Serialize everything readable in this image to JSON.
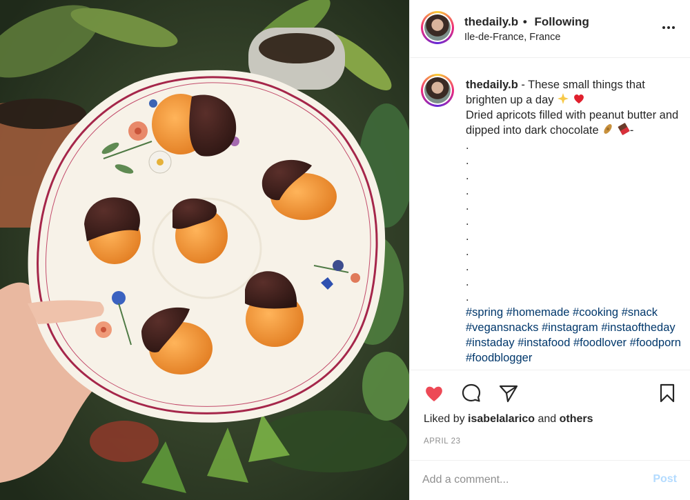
{
  "post": {
    "username": "thedaily.b",
    "follow_separator": "•",
    "follow_status": "Following",
    "location": "Ile-de-France, France"
  },
  "caption": {
    "username": "thedaily.b",
    "line1": " - These small things that brighten up a day ",
    "line2": "Dried apricots filled with peanut butter and dipped into dark chocolate ",
    "line2_tail": "-",
    "dots": [
      ".",
      ".",
      ".",
      ".",
      ".",
      ".",
      ".",
      ".",
      ".",
      ".",
      "."
    ],
    "hashtags": [
      "#spring",
      "#homemade",
      "#cooking",
      "#snack",
      "#vegansnacks",
      "#instagram",
      "#instaoftheday",
      "#instaday",
      "#instafood",
      "#foodlover",
      "#foodporn",
      "#foodblogger"
    ],
    "emojis": [
      "sparkles",
      "red-heart",
      "peanuts",
      "chocolate-bar"
    ]
  },
  "actions": {
    "liked_prefix": "Liked by ",
    "liked_user": "isabelalarico",
    "liked_and": " and ",
    "liked_others": "others",
    "date": "APRIL 23"
  },
  "comment": {
    "placeholder": "Add a comment...",
    "post_label": "Post"
  },
  "icons": {
    "more": "more-options-icon",
    "like": "heart-icon",
    "comment": "comment-bubble-icon",
    "share": "paper-plane-icon",
    "save": "bookmark-icon"
  },
  "colors": {
    "like_red": "#ed4956",
    "hashtag_blue": "#00376b",
    "post_button_disabled": "#b3dbff",
    "meta_grey": "#8e8e8e",
    "plate_rim": "#a5264a"
  }
}
